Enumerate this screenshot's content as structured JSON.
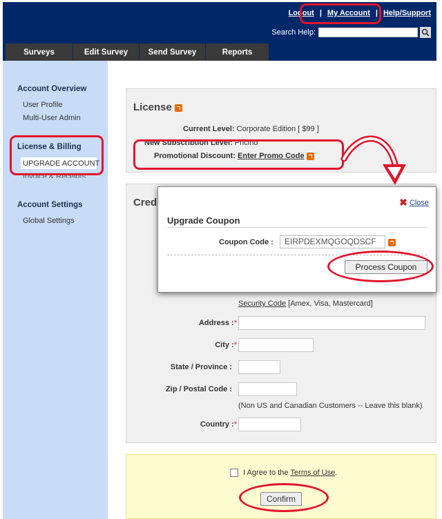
{
  "header": {
    "links": [
      "Logout",
      "My Account",
      "Help/Support"
    ],
    "search_label": "Search Help:",
    "search_value": ""
  },
  "tabs": [
    "Surveys",
    "Edit Survey",
    "Send Survey",
    "Reports"
  ],
  "sidebar": {
    "sections": [
      {
        "title": "Account Overview",
        "items": [
          "User Profile",
          "Multi-User Admin"
        ]
      },
      {
        "title": "License & Billing",
        "items": [
          "UPGRADE ACCOUNT",
          "Invoice & Receipts"
        ]
      },
      {
        "title": "Account Settings",
        "items": [
          "Global Settings"
        ]
      }
    ]
  },
  "license": {
    "title": "License",
    "current_level_label": "Current Level:",
    "current_level_value": "Corporate Edition [ $99 ]",
    "new_sub_label": "New Subscription Level:",
    "new_sub_link": "Pricing",
    "promo_label": "Promotional Discount:",
    "promo_link": "Enter Promo Code"
  },
  "credit": {
    "title": "Cred",
    "security_code_link": "Security Code",
    "security_code_note": "[Amex, Visa, Mastercard]",
    "fields": {
      "address": "Address :",
      "city": "City :",
      "state": "State / Province :",
      "zip": "Zip / Postal Code :",
      "country": "Country :"
    },
    "zip_note": "(Non US and Canadian Customers -- Leave this blank)",
    "required_mark": "*"
  },
  "modal": {
    "close_label": "Close",
    "title": "Upgrade Coupon",
    "coupon_label": "Coupon Code :",
    "coupon_value": "EIRPDEXMQGOQDSCF",
    "process_button": "Process Coupon"
  },
  "agree": {
    "text_prefix": "I Agree to the",
    "terms_link": "Terms of Use",
    "text_suffix": ".",
    "confirm_button": "Confirm"
  },
  "colors": {
    "header_bg": "#02286a",
    "tab_bg": "#3a3a3a",
    "sidebar_bg": "#c9dcf7",
    "callout": "#e3132b",
    "agree_bg": "#fdfbd0"
  }
}
